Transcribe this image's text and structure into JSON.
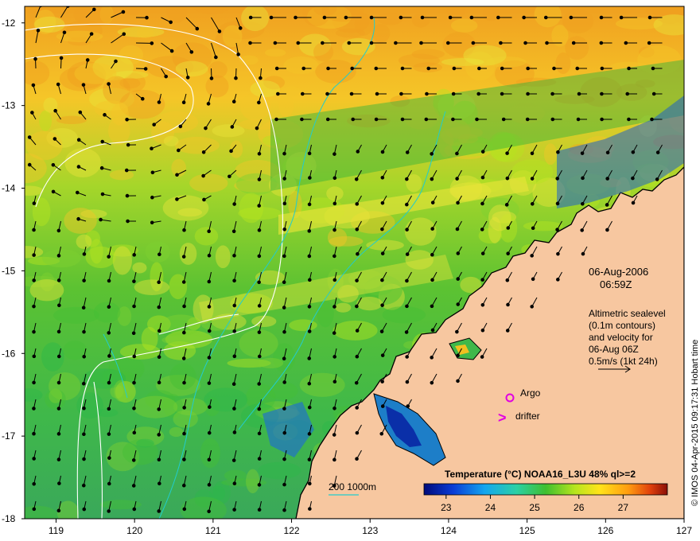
{
  "map": {
    "lon_ticks": [
      "119",
      "120",
      "121",
      "122",
      "123",
      "124",
      "125",
      "126",
      "127"
    ],
    "lat_ticks": [
      "-12",
      "-13",
      "-14",
      "-15",
      "-16",
      "-17",
      "-18"
    ],
    "lon_range": [
      118.6,
      127
    ],
    "lat_range": [
      -11.8,
      -18
    ]
  },
  "date_line": "06-Aug-2006",
  "time_line": "06:59Z",
  "altimetry_note": [
    "Altimetric sealevel",
    "(0.1m contours)",
    "and velocity for",
    "06-Aug 06Z",
    "0.5m/s (1kt 24h)"
  ],
  "legend": {
    "argo": "Argo",
    "drifter": "drifter",
    "drifter_symbol": ">",
    "depth_contours": "200  1000m"
  },
  "colorbar": {
    "title": "Temperature (°C) NOAA16_L3U 48% ql>=2",
    "ticks": [
      "23",
      "24",
      "25",
      "26",
      "27"
    ]
  },
  "credit": "© IMOS 04-Apr-2015 09:17:31 Hobart time",
  "colors": {
    "land": "#f7c7a0",
    "sst_low": "#0a2fa8",
    "sst_mid": "#2dbb3a",
    "sst_high": "#e07a10",
    "argo_drifter": "#e100e1",
    "isobath": "#22cccc",
    "sealevel_contour": "#ffffff"
  }
}
